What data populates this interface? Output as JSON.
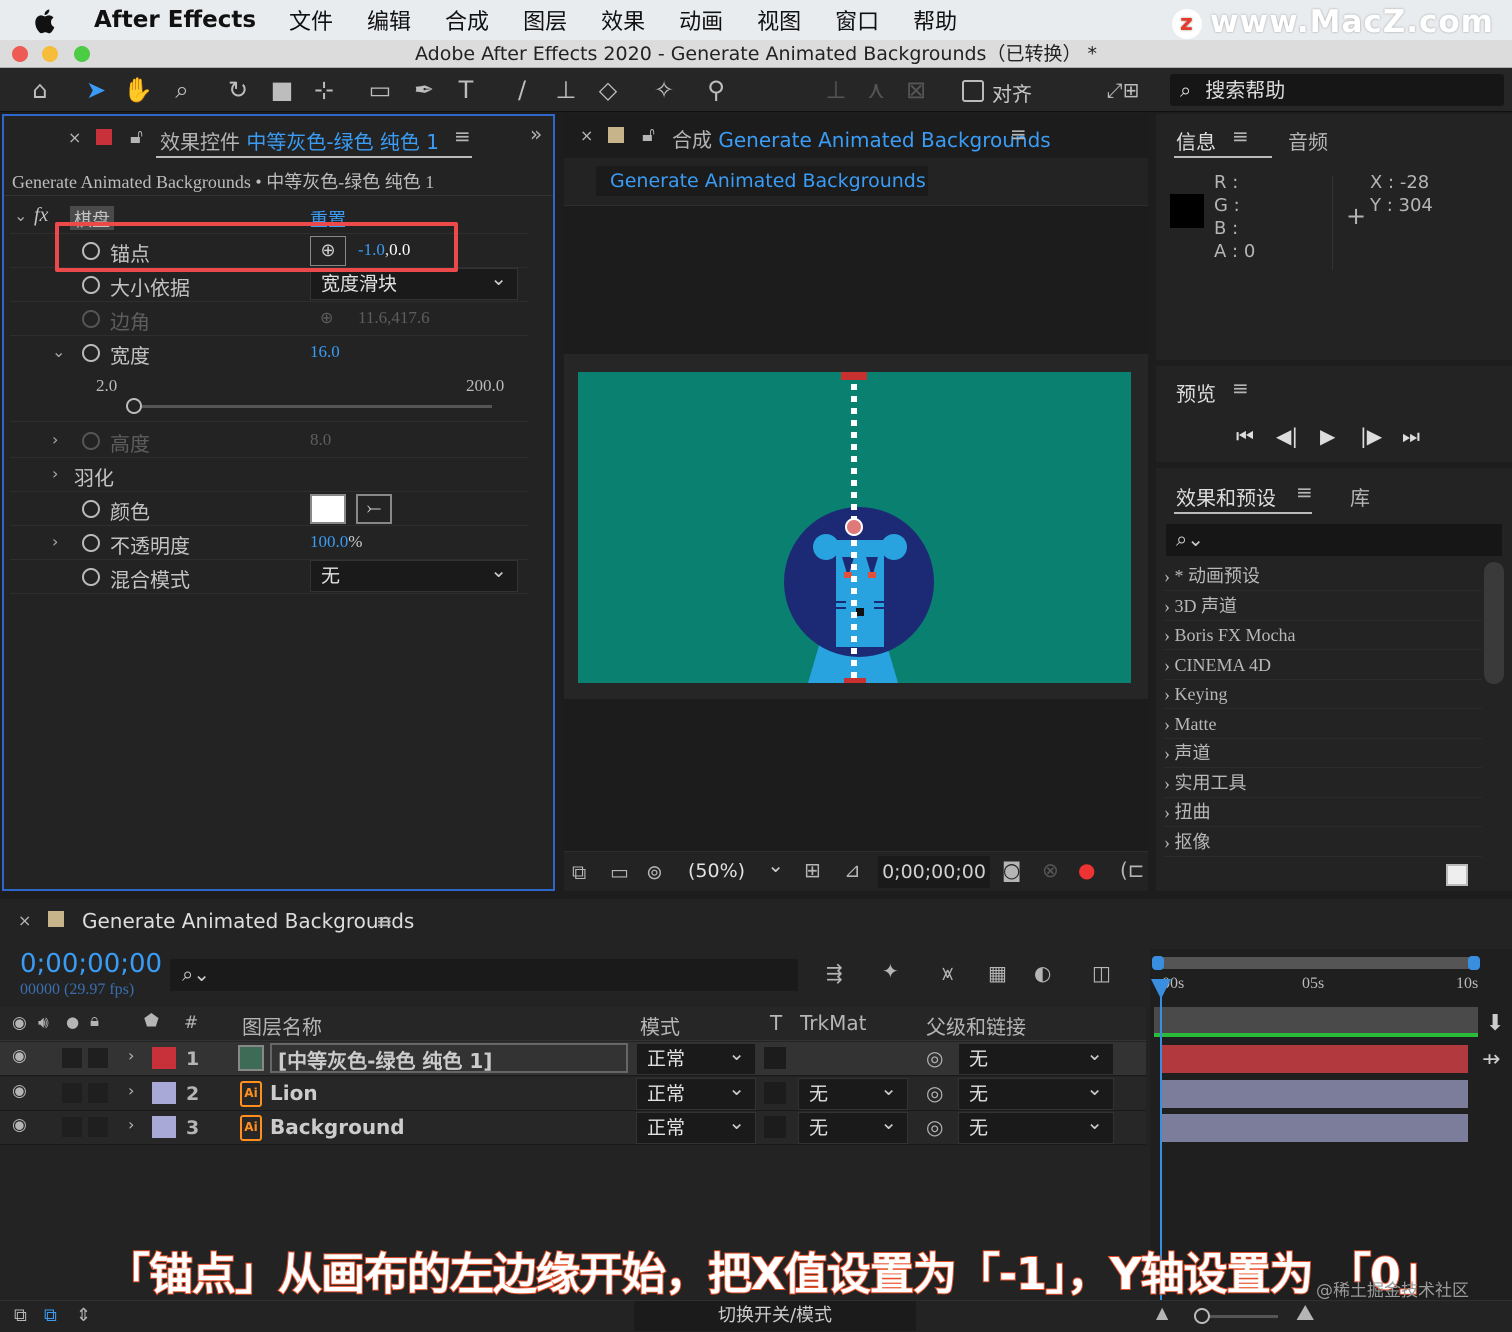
{
  "menubar": {
    "app": "After Effects",
    "items": [
      "文件",
      "编辑",
      "合成",
      "图层",
      "效果",
      "动画",
      "视图",
      "窗口",
      "帮助"
    ],
    "watermark": "www.MacZ.com"
  },
  "window": {
    "title": "Adobe After Effects 2020 - Generate Animated Backgrounds（已转换） *"
  },
  "toolbar": {
    "align_label": "对齐",
    "help_placeholder": "搜索帮助"
  },
  "effects_panel": {
    "tab_prefix": "效果控件",
    "tab_layer": "中等灰色-绿色 纯色 1",
    "breadcrumb": "Generate Animated Backgrounds • 中等灰色-绿色 纯色 1",
    "fx": "fx",
    "effect_name": "棋盘",
    "reset": "重置",
    "props": {
      "anchor": {
        "label": "锚点",
        "value_x": "-1.0",
        "value_sep": ",",
        "value_y": "0.0"
      },
      "size_from": {
        "label": "大小依据",
        "value": "宽度滑块"
      },
      "corner": {
        "label": "边角",
        "value": "11.6,417.6"
      },
      "width": {
        "label": "宽度",
        "value": "16.0",
        "min": "2.0",
        "max": "200.0",
        "fraction": 0.0
      },
      "height": {
        "label": "高度",
        "value": "8.0"
      },
      "feather": {
        "label": "羽化"
      },
      "color": {
        "label": "颜色",
        "swatch": "#ffffff"
      },
      "opacity": {
        "label": "不透明度",
        "value": "100.0",
        "unit": "%"
      },
      "blend": {
        "label": "混合模式",
        "value": "无"
      }
    }
  },
  "comp_panel": {
    "tab_prefix": "合成",
    "tab_name": "Generate Animated Backgrounds",
    "subtab": "Generate Animated Backgrounds",
    "zoom": "(50%)",
    "timecode": "0;00;00;00",
    "bg_color": "#0a8170"
  },
  "info_panel": {
    "tab": "信息",
    "tab2": "音频",
    "r": "R :",
    "g": "G :",
    "b": "B :",
    "a": "A :  0",
    "x": "X : -28",
    "y": "Y :  304"
  },
  "preview_panel": {
    "tab": "预览"
  },
  "effects_presets": {
    "tab": "效果和预设",
    "tab2": "库",
    "items": [
      "* 动画预设",
      "3D 声道",
      "Boris FX Mocha",
      "CINEMA 4D",
      "Keying",
      "Matte",
      "声道",
      "实用工具",
      "扭曲",
      "抠像"
    ]
  },
  "timeline": {
    "tab": "Generate Animated Backgrounds",
    "timecode": "0;00;00;00",
    "frames": "00000 (29.97 fps)",
    "headers": {
      "num": "#",
      "name": "图层名称",
      "mode": "模式",
      "t": "T",
      "trkmat": "TrkMat",
      "parent": "父级和链接"
    },
    "ruler": [
      "00s",
      "05s",
      "10s"
    ],
    "layers": [
      {
        "num": "1",
        "name": "[中等灰色-绿色 纯色 1]",
        "mode": "正常",
        "trkmat": "",
        "parent": "无",
        "label_color": "#c8303a",
        "bar_color": "#b23a3e"
      },
      {
        "num": "2",
        "name": "Lion",
        "mode": "正常",
        "trkmat": "无",
        "parent": "无",
        "label_color": "#a8a9d6",
        "bar_color": "#7c7d9a"
      },
      {
        "num": "3",
        "name": "Background",
        "mode": "正常",
        "trkmat": "无",
        "parent": "无",
        "label_color": "#a8a9d6",
        "bar_color": "#7c7d9a"
      }
    ],
    "footer": "切换开关/模式"
  },
  "caption": {
    "text": "「锚点」从画布的左边缘开始，把X值设置为「-1」，Y轴设置为 「0」",
    "credit": "@稀土掘金技术社区"
  }
}
